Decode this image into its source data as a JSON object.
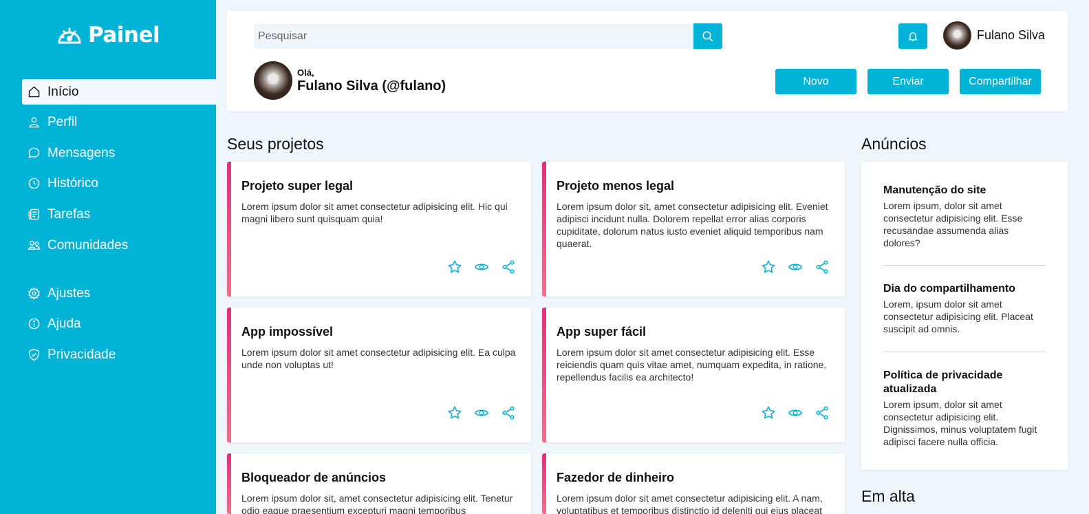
{
  "sidebar": {
    "logo": "Painel",
    "items": [
      {
        "label": "Início",
        "icon": "home-icon",
        "active": true
      },
      {
        "label": "Perfil",
        "icon": "user-icon"
      },
      {
        "label": "Mensagens",
        "icon": "chat-icon"
      },
      {
        "label": "Histórico",
        "icon": "clock-icon"
      },
      {
        "label": "Tarefas",
        "icon": "tasks-icon"
      },
      {
        "label": "Comunidades",
        "icon": "users-icon"
      },
      {
        "label": "Ajustes",
        "icon": "gear-icon"
      },
      {
        "label": "Ajuda",
        "icon": "info-icon"
      },
      {
        "label": "Privacidade",
        "icon": "shield-icon"
      }
    ]
  },
  "header": {
    "search_placeholder": "Pesquisar",
    "user_name": "Fulano Silva",
    "greeting": "Olá,",
    "full_name": "Fulano Silva (@fulano)",
    "buttons": {
      "new": "Novo",
      "send": "Enviar",
      "share": "Compartilhar"
    }
  },
  "projects": {
    "title": "Seus projetos",
    "items": [
      {
        "title": "Projeto super legal",
        "text": "Lorem ipsum dolor sit amet consectetur adipisicing elit. Hic qui magni libero sunt quisquam quia!"
      },
      {
        "title": "Projeto menos legal",
        "text": "Lorem ipsum dolor sit, amet consectetur adipisicing elit. Eveniet adipisci incidunt nulla. Dolorem repellat error alias corporis cupiditate, dolorum natus iusto eveniet aliquid temporibus nam quaerat."
      },
      {
        "title": "App impossível",
        "text": "Lorem ipsum dolor sit amet consectetur adipisicing elit. Ea culpa unde non voluptas ut!"
      },
      {
        "title": "App super fácil",
        "text": "Lorem ipsum dolor sit amet consectetur adipisicing elit. Esse reiciendis quam quis vitae amet, numquam expedita, in ratione, repellendus facilis ea architecto!"
      },
      {
        "title": "Bloqueador de anúncios",
        "text": "Lorem ipsum dolor sit, amet consectetur adipisicing elit. Tenetur odio eaque praesentium excepturi magni temporibus"
      },
      {
        "title": "Fazedor de dinheiro",
        "text": "Lorem ipsum dolor sit amet consectetur adipisicing elit. A nam, voluptatibus et temporibus distinctio id deleniti qui eius placeat"
      }
    ]
  },
  "ads": {
    "title": "Anúncios",
    "items": [
      {
        "title": "Manutenção do site",
        "text": "Lorem ipsum, dolor sit amet consectetur adipisicing elit. Esse recusandae assumenda alias dolores?"
      },
      {
        "title": "Dia do compartilhamento",
        "text": "Lorem, ipsum dolor sit amet consectetur adipisicing elit. Placeat suscipit ad omnis."
      },
      {
        "title": "Política de privacidade atualizada",
        "text": "Lorem ipsum, dolor sit amet consectetur adipisicing elit. Dignissimos, minus voluptatem fugit adipisci facere nulla officia."
      }
    ]
  },
  "trending": {
    "title": "Em alta"
  },
  "colors": {
    "accent": "#01b3d6",
    "card_border": "#e0307a",
    "background": "#eef6fc"
  }
}
